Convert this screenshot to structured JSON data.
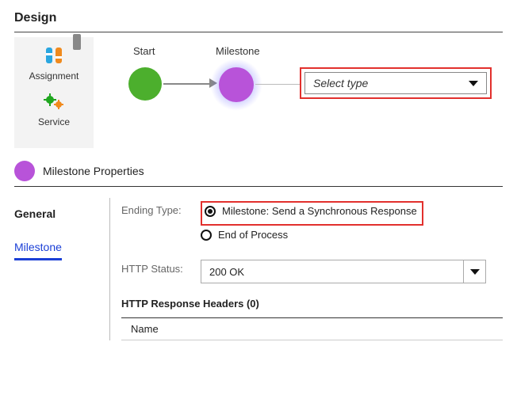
{
  "page": {
    "title": "Design"
  },
  "palette": {
    "items": [
      {
        "label": "Assignment"
      },
      {
        "label": "Service"
      }
    ]
  },
  "canvas": {
    "start_label": "Start",
    "milestone_label": "Milestone",
    "select_placeholder": "Select type"
  },
  "props": {
    "title": "Milestone Properties",
    "tabs": {
      "general": "General",
      "milestone": "Milestone"
    },
    "ending_type_label": "Ending Type:",
    "ending_type": {
      "option_milestone": "Milestone: Send a Synchronous Response",
      "option_end": "End of Process"
    },
    "http_status_label": "HTTP Status:",
    "http_status_value": "200 OK",
    "response_headers_title": "HTTP Response Headers (0)",
    "headers_col_name": "Name"
  }
}
